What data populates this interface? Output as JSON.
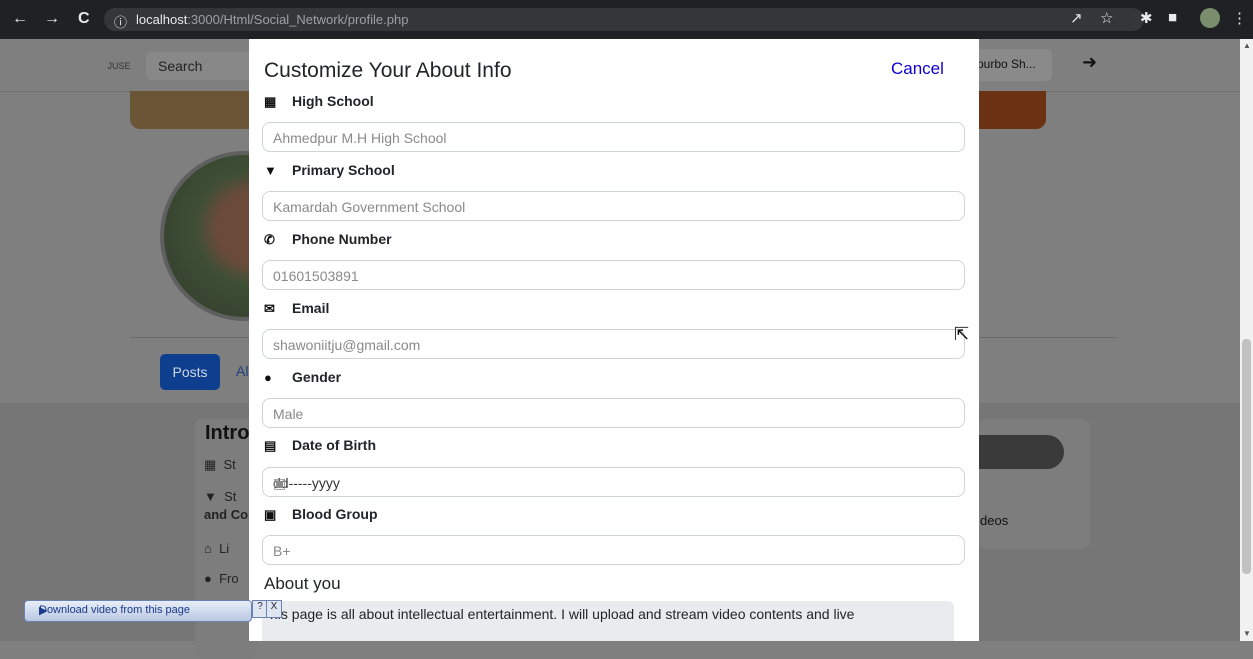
{
  "browser": {
    "url_host": "localhost",
    "url_rest": ":3000/Html/Social_Network/profile.php",
    "icons": [
      "back-icon",
      "forward-icon",
      "reload-icon",
      "info-icon",
      "share-icon",
      "star-icon",
      "extensions-icon",
      "sidepanel-icon",
      "profile-icon",
      "menu-icon"
    ]
  },
  "navbar": {
    "logo_text": "JUSE",
    "search_placeholder": "Search",
    "profile_name": "purbo Sh...",
    "logout_icon": "logout-icon"
  },
  "profile_tabs": {
    "posts": "Posts",
    "about_partial": "Al"
  },
  "intro": {
    "title": "Intro",
    "rows": [
      "St",
      "St",
      "and Co",
      "Li",
      "Fro"
    ]
  },
  "right_panel": {
    "videos": "deos"
  },
  "modal": {
    "title": "Customize Your About Info",
    "cancel": "Cancel",
    "fields": [
      {
        "label": "High School",
        "icon": "school-icon",
        "value": "Ahmedpur M.H High School"
      },
      {
        "label": "Primary School",
        "icon": "graduation-cap-icon",
        "value": "Kamardah Government School"
      },
      {
        "label": "Phone Number",
        "icon": "phone-icon",
        "value": "01601503891"
      },
      {
        "label": "Email",
        "icon": "envelope-icon",
        "value": "shawoniitju@gmail.com"
      },
      {
        "label": "Gender",
        "icon": "person-icon",
        "value": "Male"
      },
      {
        "label": "Date of Birth",
        "icon": "birthday-cake-icon",
        "value": "dd-----yyyy"
      },
      {
        "label": "Blood Group",
        "icon": "medkit-icon",
        "value": "B+"
      }
    ],
    "about_title": "About you",
    "about_text": "his page is all about intellectual entertainment. I will upload and stream video contents and live"
  },
  "download_bar": {
    "label": "Download video from this page",
    "help": "?",
    "close": "X"
  }
}
